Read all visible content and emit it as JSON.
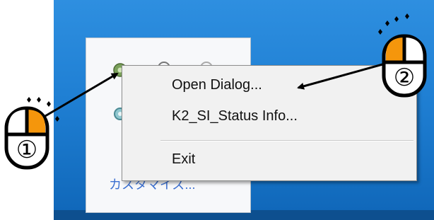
{
  "tray": {
    "customize_label": "カスタマイズ..."
  },
  "menu": {
    "items": [
      {
        "label": "Open Dialog..."
      },
      {
        "label": "K2_SI_Status Info..."
      },
      {
        "label": "Exit"
      }
    ]
  },
  "annotations": {
    "step1": "①",
    "step2": "②",
    "mouse_button_color": "#f5960c"
  },
  "icons": [
    "gear-tray-icon",
    "mouse-left-click-icon",
    "sparkle-icon",
    "arrow-icon"
  ]
}
